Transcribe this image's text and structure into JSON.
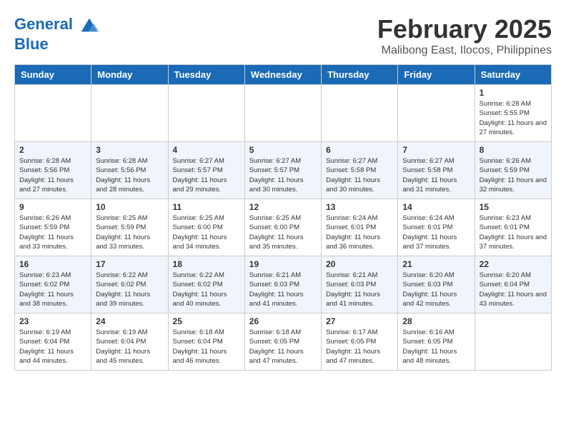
{
  "logo": {
    "line1": "General",
    "line2": "Blue"
  },
  "title": "February 2025",
  "location": "Malibong East, Ilocos, Philippines",
  "weekdays": [
    "Sunday",
    "Monday",
    "Tuesday",
    "Wednesday",
    "Thursday",
    "Friday",
    "Saturday"
  ],
  "weeks": [
    [
      {
        "day": "",
        "info": ""
      },
      {
        "day": "",
        "info": ""
      },
      {
        "day": "",
        "info": ""
      },
      {
        "day": "",
        "info": ""
      },
      {
        "day": "",
        "info": ""
      },
      {
        "day": "",
        "info": ""
      },
      {
        "day": "1",
        "info": "Sunrise: 6:28 AM\nSunset: 5:55 PM\nDaylight: 11 hours and 27 minutes."
      }
    ],
    [
      {
        "day": "2",
        "info": "Sunrise: 6:28 AM\nSunset: 5:56 PM\nDaylight: 11 hours and 27 minutes."
      },
      {
        "day": "3",
        "info": "Sunrise: 6:28 AM\nSunset: 5:56 PM\nDaylight: 11 hours and 28 minutes."
      },
      {
        "day": "4",
        "info": "Sunrise: 6:27 AM\nSunset: 5:57 PM\nDaylight: 11 hours and 29 minutes."
      },
      {
        "day": "5",
        "info": "Sunrise: 6:27 AM\nSunset: 5:57 PM\nDaylight: 11 hours and 30 minutes."
      },
      {
        "day": "6",
        "info": "Sunrise: 6:27 AM\nSunset: 5:58 PM\nDaylight: 11 hours and 30 minutes."
      },
      {
        "day": "7",
        "info": "Sunrise: 6:27 AM\nSunset: 5:58 PM\nDaylight: 11 hours and 31 minutes."
      },
      {
        "day": "8",
        "info": "Sunrise: 6:26 AM\nSunset: 5:59 PM\nDaylight: 11 hours and 32 minutes."
      }
    ],
    [
      {
        "day": "9",
        "info": "Sunrise: 6:26 AM\nSunset: 5:59 PM\nDaylight: 11 hours and 33 minutes."
      },
      {
        "day": "10",
        "info": "Sunrise: 6:25 AM\nSunset: 5:59 PM\nDaylight: 11 hours and 33 minutes."
      },
      {
        "day": "11",
        "info": "Sunrise: 6:25 AM\nSunset: 6:00 PM\nDaylight: 11 hours and 34 minutes."
      },
      {
        "day": "12",
        "info": "Sunrise: 6:25 AM\nSunset: 6:00 PM\nDaylight: 11 hours and 35 minutes."
      },
      {
        "day": "13",
        "info": "Sunrise: 6:24 AM\nSunset: 6:01 PM\nDaylight: 11 hours and 36 minutes."
      },
      {
        "day": "14",
        "info": "Sunrise: 6:24 AM\nSunset: 6:01 PM\nDaylight: 11 hours and 37 minutes."
      },
      {
        "day": "15",
        "info": "Sunrise: 6:23 AM\nSunset: 6:01 PM\nDaylight: 11 hours and 37 minutes."
      }
    ],
    [
      {
        "day": "16",
        "info": "Sunrise: 6:23 AM\nSunset: 6:02 PM\nDaylight: 11 hours and 38 minutes."
      },
      {
        "day": "17",
        "info": "Sunrise: 6:22 AM\nSunset: 6:02 PM\nDaylight: 11 hours and 39 minutes."
      },
      {
        "day": "18",
        "info": "Sunrise: 6:22 AM\nSunset: 6:02 PM\nDaylight: 11 hours and 40 minutes."
      },
      {
        "day": "19",
        "info": "Sunrise: 6:21 AM\nSunset: 6:03 PM\nDaylight: 11 hours and 41 minutes."
      },
      {
        "day": "20",
        "info": "Sunrise: 6:21 AM\nSunset: 6:03 PM\nDaylight: 11 hours and 41 minutes."
      },
      {
        "day": "21",
        "info": "Sunrise: 6:20 AM\nSunset: 6:03 PM\nDaylight: 11 hours and 42 minutes."
      },
      {
        "day": "22",
        "info": "Sunrise: 6:20 AM\nSunset: 6:04 PM\nDaylight: 11 hours and 43 minutes."
      }
    ],
    [
      {
        "day": "23",
        "info": "Sunrise: 6:19 AM\nSunset: 6:04 PM\nDaylight: 11 hours and 44 minutes."
      },
      {
        "day": "24",
        "info": "Sunrise: 6:19 AM\nSunset: 6:04 PM\nDaylight: 11 hours and 45 minutes."
      },
      {
        "day": "25",
        "info": "Sunrise: 6:18 AM\nSunset: 6:04 PM\nDaylight: 11 hours and 46 minutes."
      },
      {
        "day": "26",
        "info": "Sunrise: 6:18 AM\nSunset: 6:05 PM\nDaylight: 11 hours and 47 minutes."
      },
      {
        "day": "27",
        "info": "Sunrise: 6:17 AM\nSunset: 6:05 PM\nDaylight: 11 hours and 47 minutes."
      },
      {
        "day": "28",
        "info": "Sunrise: 6:16 AM\nSunset: 6:05 PM\nDaylight: 11 hours and 48 minutes."
      },
      {
        "day": "",
        "info": ""
      }
    ]
  ]
}
